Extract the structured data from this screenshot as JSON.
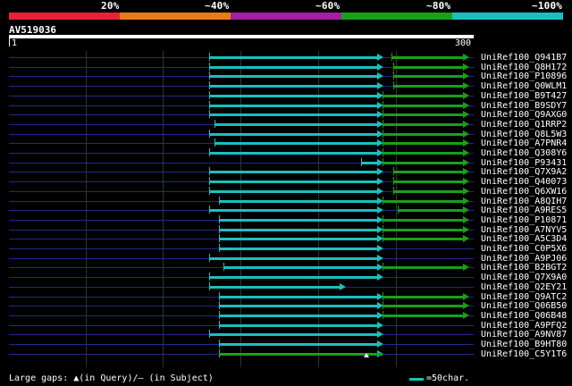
{
  "percent_labels": [
    "20%",
    "~40%",
    "~60%",
    "~80%",
    "~100%"
  ],
  "colors": {
    "identity_bands": [
      "#e8213b",
      "#e87a1a",
      "#a020a0",
      "#19a019",
      "#19c0c0"
    ],
    "query_hit": "#19c0c0",
    "subject_hit": "#19a019",
    "background_line": "#1f2a8a"
  },
  "query": {
    "id": "AV519036",
    "start": "1",
    "end": "300"
  },
  "hits": [
    {
      "label": "UniRef100_Q941B7"
    },
    {
      "label": "UniRef100_Q8H172"
    },
    {
      "label": "UniRef100_P10896"
    },
    {
      "label": "UniRef100_Q0WLM1"
    },
    {
      "label": "UniRef100_B9T427"
    },
    {
      "label": "UniRef100_B9SDY7"
    },
    {
      "label": "UniRef100_Q9AXG0"
    },
    {
      "label": "UniRef100_Q1RRP2"
    },
    {
      "label": "UniRef100_Q8L5W3"
    },
    {
      "label": "UniRef100_A7PNR4"
    },
    {
      "label": "UniRef100_Q308Y6"
    },
    {
      "label": "UniRef100_P93431"
    },
    {
      "label": "UniRef100_Q7X9A2"
    },
    {
      "label": "UniRef100_Q40073"
    },
    {
      "label": "UniRef100_Q6XW16"
    },
    {
      "label": "UniRef100_A8QIH7"
    },
    {
      "label": "UniRef100_A9RES5"
    },
    {
      "label": "UniRef100_P10871"
    },
    {
      "label": "UniRef100_A7NYV5"
    },
    {
      "label": "UniRef100_A5C3D4"
    },
    {
      "label": "UniRef100_C0P5X6"
    },
    {
      "label": "UniRef100_A9PJ06"
    },
    {
      "label": "UniRef100_B2BGT2"
    },
    {
      "label": "UniRef100_Q7X9A0"
    },
    {
      "label": "UniRef100_Q2EY21"
    },
    {
      "label": "UniRef100_Q9ATC2"
    },
    {
      "label": "UniRef100_Q06B50"
    },
    {
      "label": "UniRef100_Q06B48"
    },
    {
      "label": "UniRef100_A9PFQ2"
    },
    {
      "label": "UniRef100_A9NV87"
    },
    {
      "label": "UniRef100_B9HT80"
    },
    {
      "label": "UniRef100_C5Y1T6"
    }
  ],
  "legend": {
    "gaps_text": "Large gaps: ▲(in Query)/– (in Subject)",
    "scale_text": "=50char."
  }
}
